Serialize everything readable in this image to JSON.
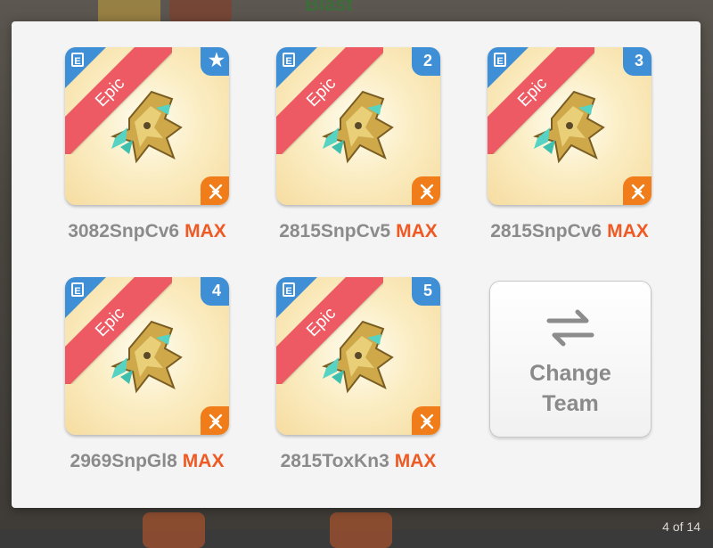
{
  "background": {
    "title": "Blast",
    "page_indicator": "4 of 14"
  },
  "cards": [
    {
      "rarity": "Epic",
      "rank": "",
      "rank_icon": "star-icon",
      "name": "3082SnpCv6",
      "level": "MAX"
    },
    {
      "rarity": "Epic",
      "rank": "2",
      "name": "2815SnpCv5",
      "level": "MAX"
    },
    {
      "rarity": "Epic",
      "rank": "3",
      "name": "2815SnpCv6",
      "level": "MAX"
    },
    {
      "rarity": "Epic",
      "rank": "4",
      "name": "2969SnpGl8",
      "level": "MAX"
    },
    {
      "rarity": "Epic",
      "rank": "5",
      "name": "2815ToxKn3",
      "level": "MAX"
    }
  ],
  "change_team": {
    "line1": "Change",
    "line2": "Team"
  },
  "colors": {
    "rarity_ribbon": "#ee5a63",
    "rank_badge": "#3f8fd6",
    "element_badge": "#f07d1a",
    "max_text": "#ef5a24"
  }
}
